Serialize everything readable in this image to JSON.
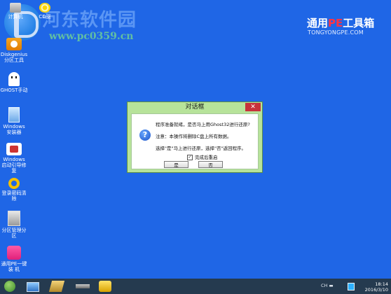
{
  "watermark": {
    "title": "河东软件园",
    "url": "www.pc0359.cn"
  },
  "brand": {
    "name_prefix": "通用",
    "name_pe": "PE",
    "name_suffix": "工具箱",
    "site": "TONGYONGPE.COM"
  },
  "desktop_icons": [
    {
      "label": "计算机"
    },
    {
      "label": "CD驱"
    },
    {
      "label": "Diskgenius 分区工具"
    },
    {
      "label": "GHOST手动"
    },
    {
      "label": "Windows 安装器"
    },
    {
      "label": "Windows 启动引导修复"
    },
    {
      "label": "登录密码清除"
    },
    {
      "label": "分区管理分区"
    },
    {
      "label": "通用PE一键装 机"
    }
  ],
  "dialog": {
    "title": "对话框",
    "close": "✕",
    "line1": "程序准备就绪，是否马上用Ghost32进行还原?",
    "line2": "注意：本操作将删除C盘上所有数据。",
    "line3": "选择\"是\"马上进行还原，选择\"否\"返回程序。",
    "checkbox_label": "完成后重启",
    "checkbox_checked": true,
    "yes": "是",
    "no": "否"
  },
  "taskbar": {
    "tray_text": "CH ▬",
    "time": "18:14",
    "date": "2016/3/10"
  },
  "colors": {
    "desktop": "#1f66e6",
    "dialog_frame": "#b7e39a",
    "taskbar": "#253a4f",
    "close_button": "#c7323a"
  }
}
